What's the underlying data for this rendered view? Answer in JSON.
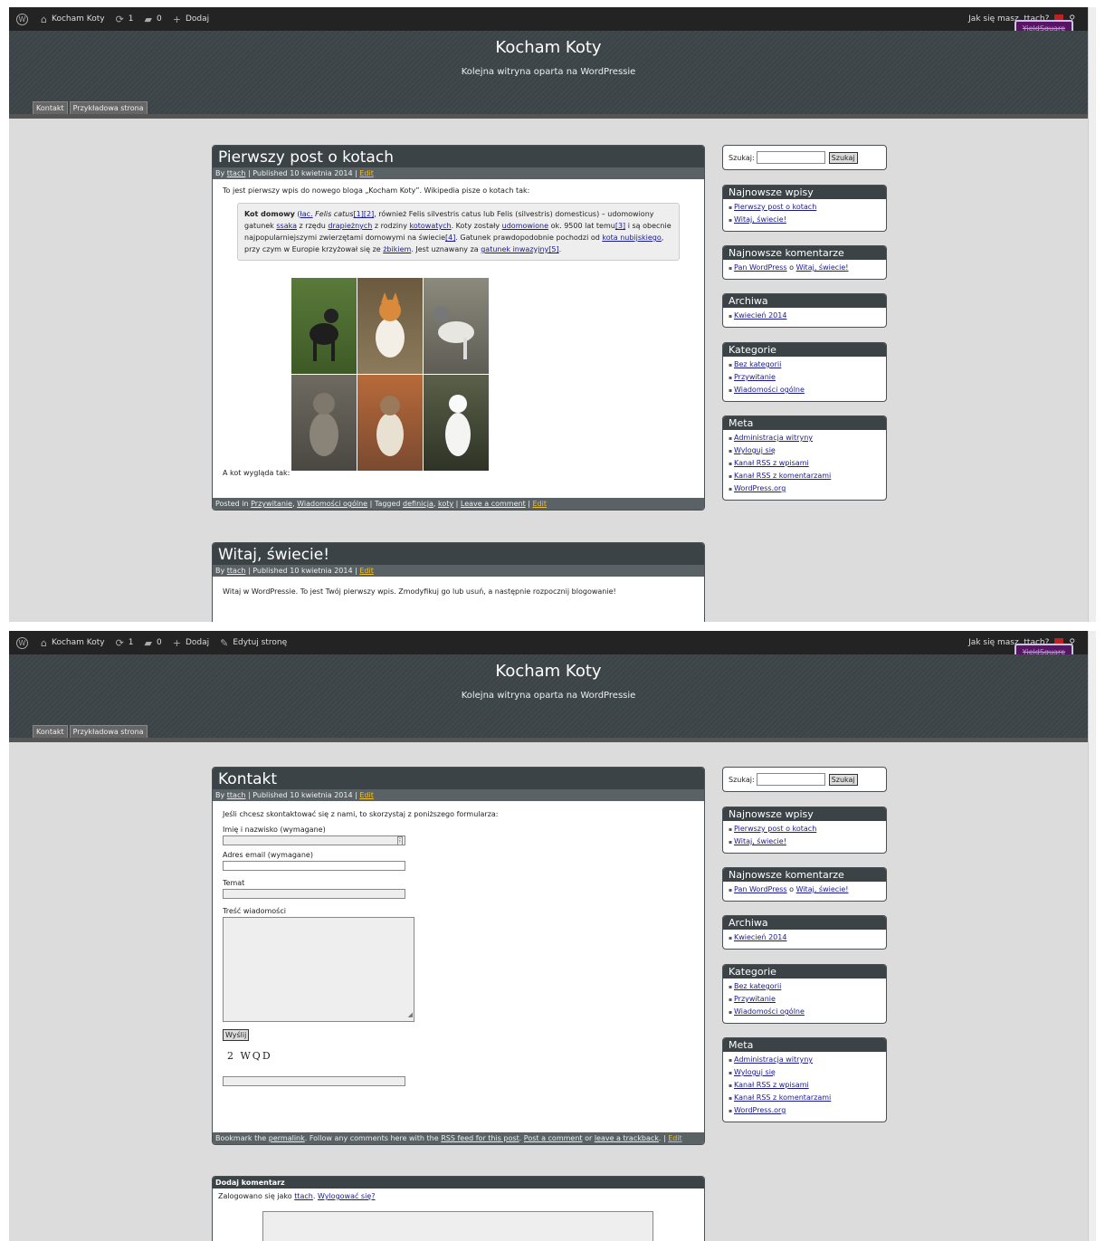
{
  "admin": {
    "site": "Kocham Koty",
    "updates": "1",
    "comments": "0",
    "add": "Dodaj",
    "edit_page": "Edytuj stronę",
    "greeting": "Jak się masz, ttach?",
    "yield": "YieldSquare"
  },
  "site": {
    "title": "Kocham Koty",
    "tagline": "Kolejna witryna oparta na WordPressie",
    "nav": [
      "Kontakt",
      "Przykładowa strona"
    ]
  },
  "post1": {
    "title": "Pierwszy post o kotach",
    "meta_by": "By",
    "author": "ttach",
    "published": "| Published 10 kwietnia 2014 |",
    "edit": "Edit",
    "intro": "To jest pierwszy wpis do nowego bloga „Kocham Koty”. Wikipedia pisze o kotach tak:",
    "quote": {
      "bold": "Kot domowy",
      "p1": " (",
      "lac": "łac.",
      "p2": " Felis catus",
      "r12": "[1][2]",
      "p3": ", również Felis silvestris catus lub Felis (silvestris) domesticus) – udomowiony gatunek ",
      "ssaka": "ssaka",
      "p4": " z rzędu ",
      "drap": "drapieżnych",
      "p5": " z rodziny ",
      "kotow": "kotowatych",
      "p6": ". Koty zostały ",
      "udom": "udomowione",
      "p7": " ok. 9500 lat temu",
      "r3": "[3]",
      "p8": " i są obecnie najpopularniejszymi zwierzętami domowymi na świecie",
      "r4": "[4]",
      "p9": ". Gatunek prawdopodobnie pochodzi od ",
      "nub": "kota nubijskiego",
      "p10": ", przy czym w Europie krzyżował się ze ",
      "zbik": "żbikiem",
      "p11": ". Jest uznawany za ",
      "inw": "gatunek inwazyjny",
      "r5": "[5]",
      "p12": "."
    },
    "outro": "A kot wygląda tak:",
    "foot": {
      "posted": "Posted in",
      "c1": "Przywitanie",
      "c2": "Wiadomości ogólne",
      "tagged": "| Tagged",
      "t1": "definicja",
      "t2": "koty",
      "leave": "Leave a comment",
      "edit": "Edit"
    }
  },
  "post2": {
    "title": "Witaj, świecie!",
    "meta_by": "By",
    "author": "ttach",
    "published": "| Published 10 kwietnia 2014 |",
    "edit": "Edit",
    "body": "Witaj w WordPressie. To jest Twój pierwszy wpis. Zmodyfikuj go lub usuń, a następnie rozpocznij blogowanie!"
  },
  "sidebar": {
    "search_label": "Szukaj:",
    "search_btn": "Szukaj",
    "recent_title": "Najnowsze wpisy",
    "recent": [
      "Pierwszy post o kotach",
      "Witaj, świecie!"
    ],
    "comments_title": "Najnowsze komentarze",
    "comment_author": "Pan WordPress",
    "comment_o": "o",
    "comment_post": "Witaj, świecie!",
    "archive_title": "Archiwa",
    "archives": [
      "Kwiecień 2014"
    ],
    "cat_title": "Kategorie",
    "cats": [
      "Bez kategorii",
      "Przywitanie",
      "Wiadomości ogólne"
    ],
    "meta_title": "Meta",
    "meta": [
      "Administracja witryny",
      "Wyloguj się",
      "Kanał RSS z wpisami",
      "Kanał RSS z komentarzami",
      "WordPress.org"
    ]
  },
  "contact": {
    "title": "Kontakt",
    "meta_by": "By",
    "author": "ttach",
    "published": "| Published 10 kwietnia 2014 |",
    "edit": "Edit",
    "intro": "Jeśli chcesz skontaktować się z nami, to skorzystaj z poniższego formularza:",
    "name_label": "Imię i nazwisko (wymagane)",
    "email_label": "Adres email (wymagane)",
    "subject_label": "Temat",
    "message_label": "Treść wiadomości",
    "send": "Wyślij",
    "captcha": "2 WQD",
    "foot": {
      "t1": "Bookmark the",
      "permalink": "permalink",
      "t2": ". Follow any comments here with the",
      "rss": "RSS feed for this post",
      "t3": ".",
      "post": "Post a comment",
      "t4": "or",
      "track": "leave a trackback",
      "t5": ". |",
      "edit": "Edit"
    }
  },
  "comment": {
    "title": "Dodaj komentarz",
    "logged": "Zalogowano się jako",
    "user": "ttach",
    "logout": "Wylogować się?"
  },
  "colors": {
    "header": "#3b4347",
    "bg": "#dcdcdc",
    "accent": "#f0c030"
  }
}
